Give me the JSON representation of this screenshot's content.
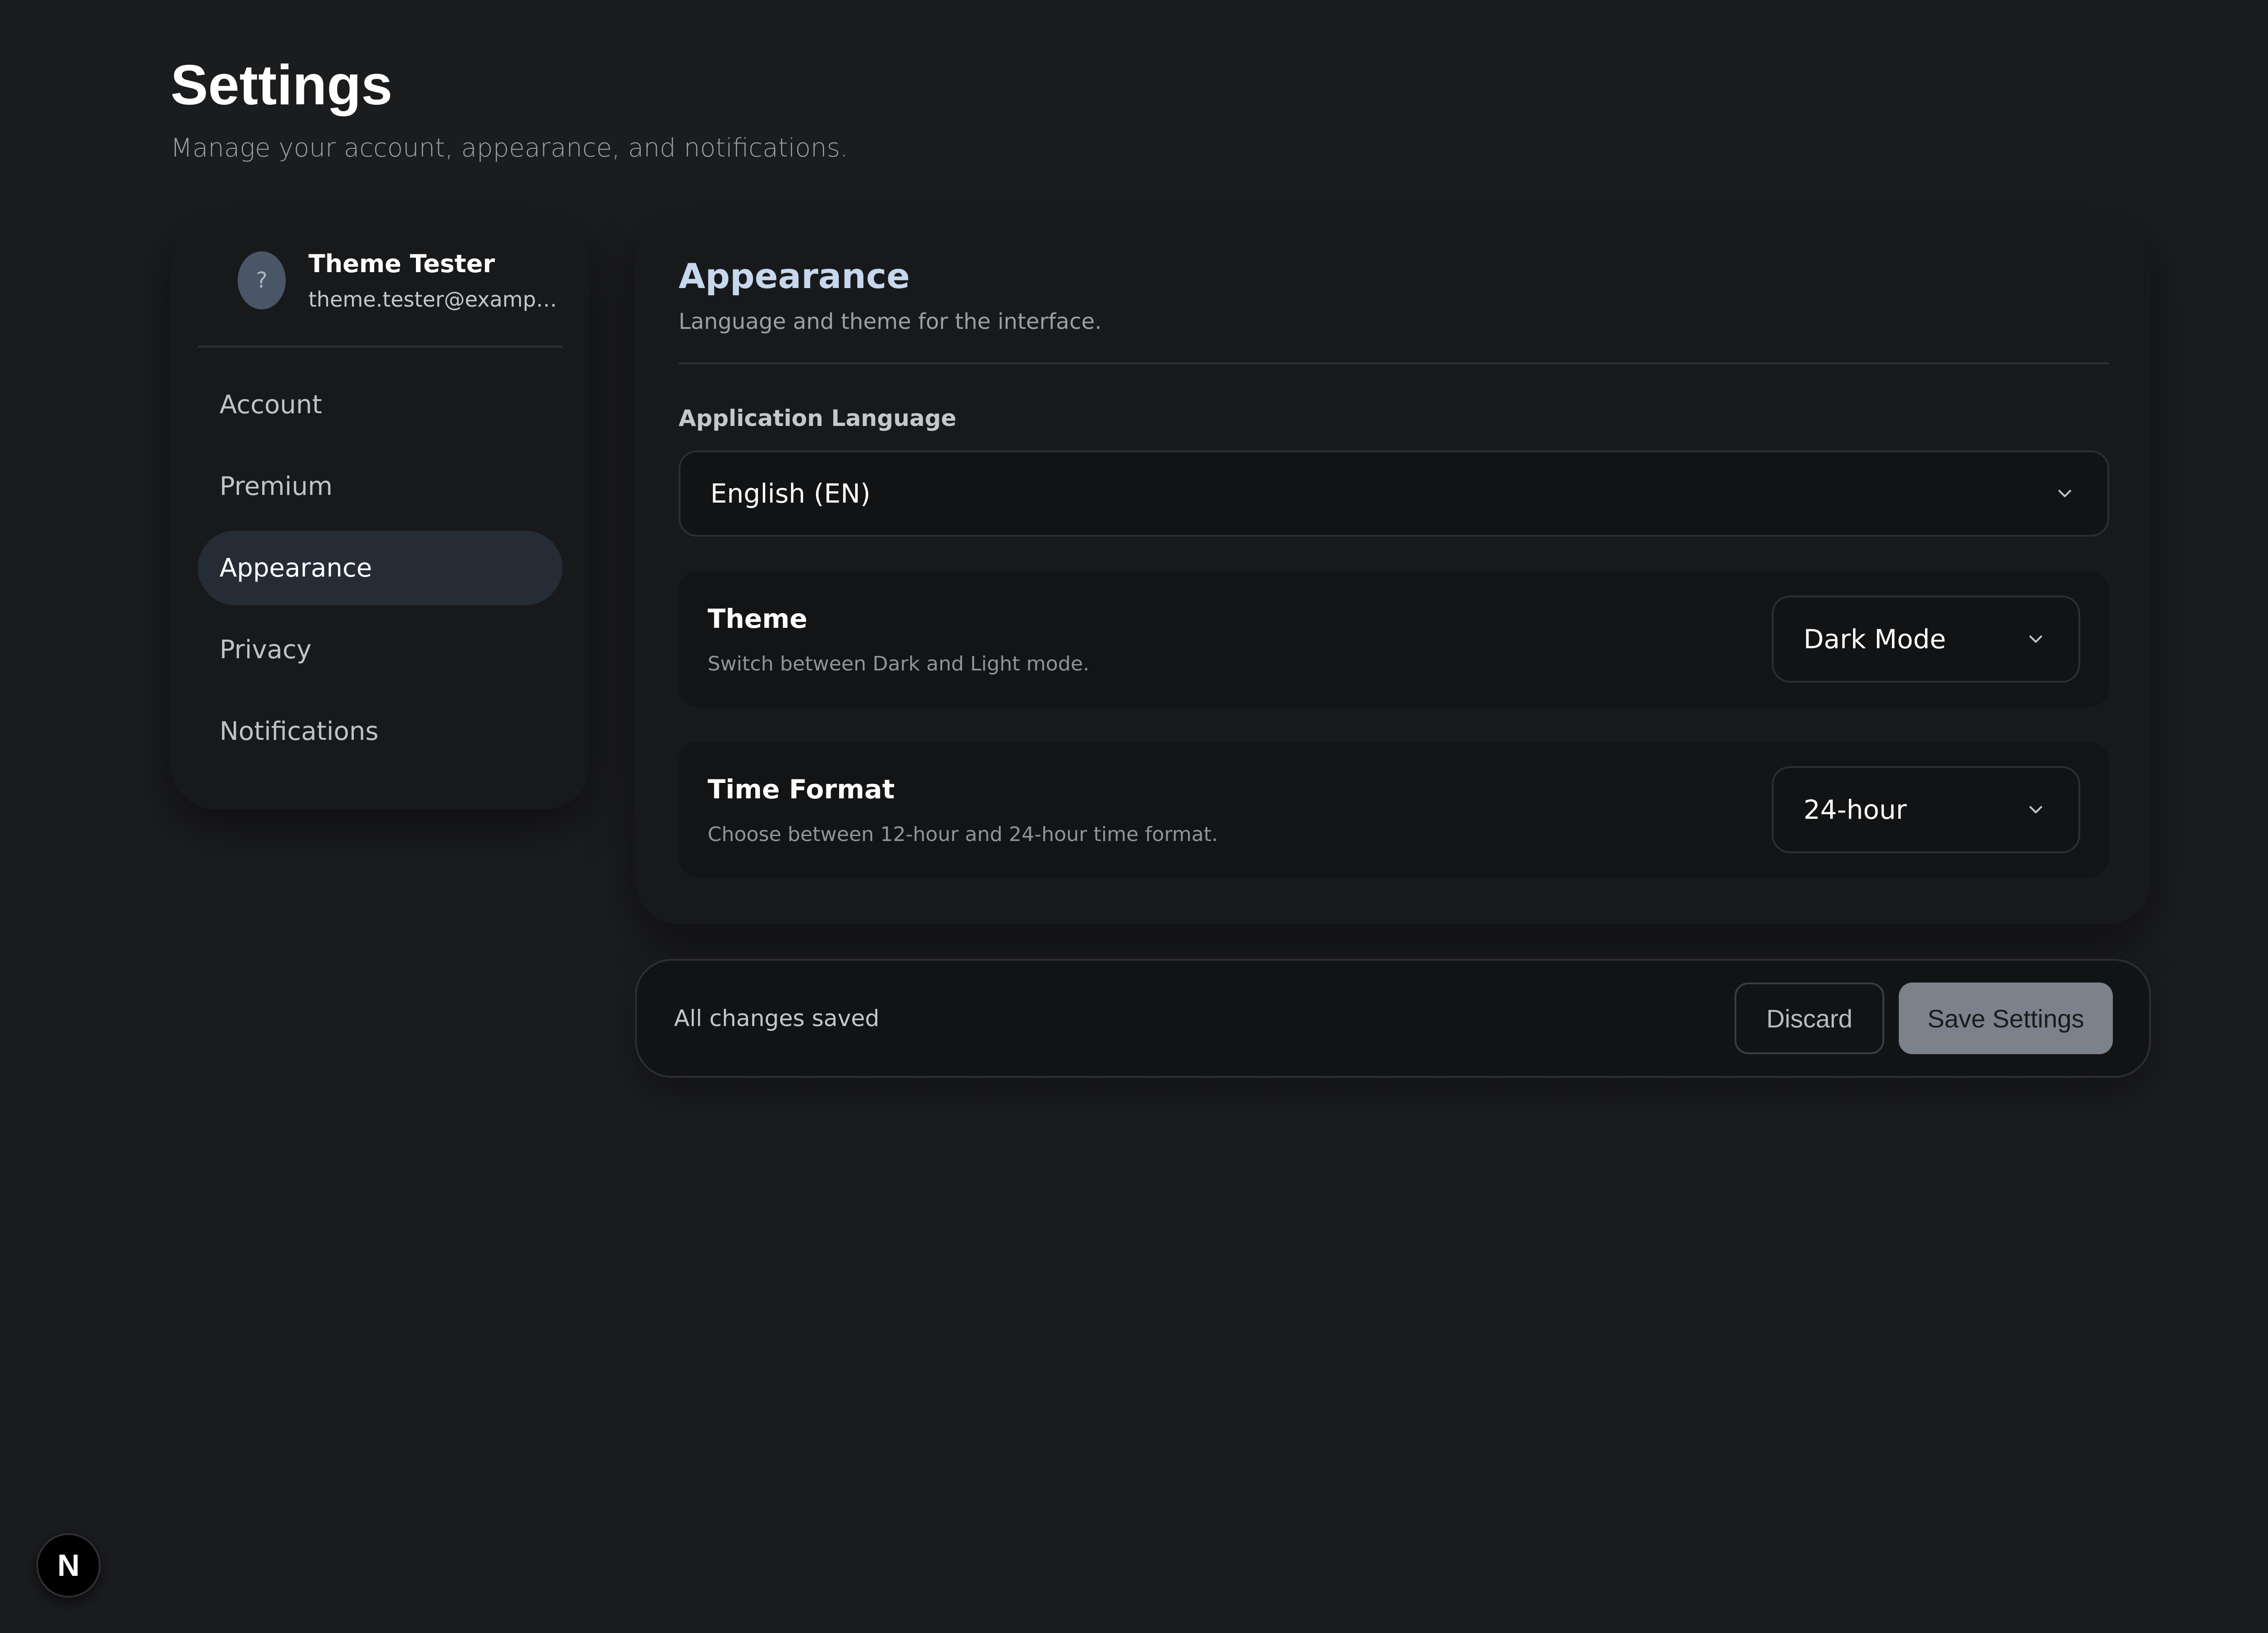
{
  "page": {
    "title": "Settings",
    "subtitle": "Manage your account, appearance, and notifications."
  },
  "profile": {
    "avatar_glyph": "?",
    "name": "Theme Tester",
    "email": "theme.tester@example.com"
  },
  "sidebar": {
    "items": [
      {
        "label": "Account",
        "active": false
      },
      {
        "label": "Premium",
        "active": false
      },
      {
        "label": "Appearance",
        "active": true
      },
      {
        "label": "Privacy",
        "active": false
      },
      {
        "label": "Notifications",
        "active": false
      }
    ]
  },
  "appearance": {
    "title": "Appearance",
    "subtitle": "Language and theme for the interface.",
    "language": {
      "label": "Application Language",
      "value": "English (EN)"
    },
    "theme": {
      "title": "Theme",
      "description": "Switch between Dark and Light mode.",
      "value": "Dark Mode"
    },
    "time_format": {
      "title": "Time Format",
      "description": "Choose between 12-hour and 24-hour time format.",
      "value": "24-hour"
    }
  },
  "save_bar": {
    "status": "All changes saved",
    "discard_label": "Discard",
    "save_label": "Save Settings"
  },
  "badge": {
    "label": "N"
  },
  "icons": {
    "dropdown": "chevron-down-icon",
    "badge": "nextjs-icon"
  },
  "colors": {
    "background": "#1b1c1e",
    "card": "#18191b",
    "active_nav": "#262c36",
    "section_title": "#c6d7ee",
    "save_button": "#7c828b"
  }
}
